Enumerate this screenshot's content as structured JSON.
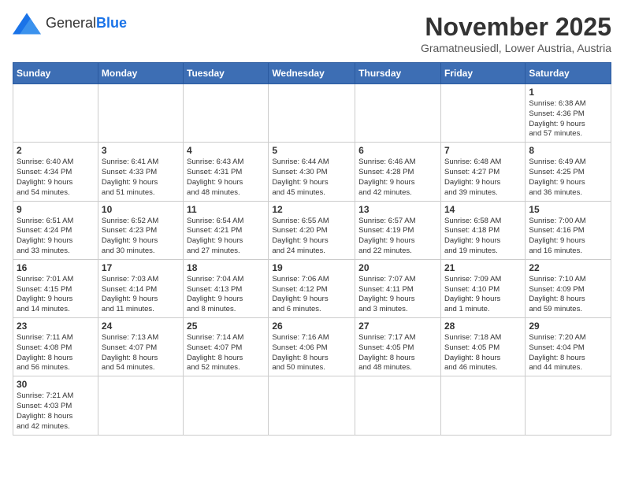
{
  "header": {
    "logo_general": "General",
    "logo_blue": "Blue",
    "title": "November 2025",
    "subtitle": "Gramatneusiedl, Lower Austria, Austria"
  },
  "weekdays": [
    "Sunday",
    "Monday",
    "Tuesday",
    "Wednesday",
    "Thursday",
    "Friday",
    "Saturday"
  ],
  "weeks": [
    [
      {
        "day": "",
        "info": ""
      },
      {
        "day": "",
        "info": ""
      },
      {
        "day": "",
        "info": ""
      },
      {
        "day": "",
        "info": ""
      },
      {
        "day": "",
        "info": ""
      },
      {
        "day": "",
        "info": ""
      },
      {
        "day": "1",
        "info": "Sunrise: 6:38 AM\nSunset: 4:36 PM\nDaylight: 9 hours\nand 57 minutes."
      }
    ],
    [
      {
        "day": "2",
        "info": "Sunrise: 6:40 AM\nSunset: 4:34 PM\nDaylight: 9 hours\nand 54 minutes."
      },
      {
        "day": "3",
        "info": "Sunrise: 6:41 AM\nSunset: 4:33 PM\nDaylight: 9 hours\nand 51 minutes."
      },
      {
        "day": "4",
        "info": "Sunrise: 6:43 AM\nSunset: 4:31 PM\nDaylight: 9 hours\nand 48 minutes."
      },
      {
        "day": "5",
        "info": "Sunrise: 6:44 AM\nSunset: 4:30 PM\nDaylight: 9 hours\nand 45 minutes."
      },
      {
        "day": "6",
        "info": "Sunrise: 6:46 AM\nSunset: 4:28 PM\nDaylight: 9 hours\nand 42 minutes."
      },
      {
        "day": "7",
        "info": "Sunrise: 6:48 AM\nSunset: 4:27 PM\nDaylight: 9 hours\nand 39 minutes."
      },
      {
        "day": "8",
        "info": "Sunrise: 6:49 AM\nSunset: 4:25 PM\nDaylight: 9 hours\nand 36 minutes."
      }
    ],
    [
      {
        "day": "9",
        "info": "Sunrise: 6:51 AM\nSunset: 4:24 PM\nDaylight: 9 hours\nand 33 minutes."
      },
      {
        "day": "10",
        "info": "Sunrise: 6:52 AM\nSunset: 4:23 PM\nDaylight: 9 hours\nand 30 minutes."
      },
      {
        "day": "11",
        "info": "Sunrise: 6:54 AM\nSunset: 4:21 PM\nDaylight: 9 hours\nand 27 minutes."
      },
      {
        "day": "12",
        "info": "Sunrise: 6:55 AM\nSunset: 4:20 PM\nDaylight: 9 hours\nand 24 minutes."
      },
      {
        "day": "13",
        "info": "Sunrise: 6:57 AM\nSunset: 4:19 PM\nDaylight: 9 hours\nand 22 minutes."
      },
      {
        "day": "14",
        "info": "Sunrise: 6:58 AM\nSunset: 4:18 PM\nDaylight: 9 hours\nand 19 minutes."
      },
      {
        "day": "15",
        "info": "Sunrise: 7:00 AM\nSunset: 4:16 PM\nDaylight: 9 hours\nand 16 minutes."
      }
    ],
    [
      {
        "day": "16",
        "info": "Sunrise: 7:01 AM\nSunset: 4:15 PM\nDaylight: 9 hours\nand 14 minutes."
      },
      {
        "day": "17",
        "info": "Sunrise: 7:03 AM\nSunset: 4:14 PM\nDaylight: 9 hours\nand 11 minutes."
      },
      {
        "day": "18",
        "info": "Sunrise: 7:04 AM\nSunset: 4:13 PM\nDaylight: 9 hours\nand 8 minutes."
      },
      {
        "day": "19",
        "info": "Sunrise: 7:06 AM\nSunset: 4:12 PM\nDaylight: 9 hours\nand 6 minutes."
      },
      {
        "day": "20",
        "info": "Sunrise: 7:07 AM\nSunset: 4:11 PM\nDaylight: 9 hours\nand 3 minutes."
      },
      {
        "day": "21",
        "info": "Sunrise: 7:09 AM\nSunset: 4:10 PM\nDaylight: 9 hours\nand 1 minute."
      },
      {
        "day": "22",
        "info": "Sunrise: 7:10 AM\nSunset: 4:09 PM\nDaylight: 8 hours\nand 59 minutes."
      }
    ],
    [
      {
        "day": "23",
        "info": "Sunrise: 7:11 AM\nSunset: 4:08 PM\nDaylight: 8 hours\nand 56 minutes."
      },
      {
        "day": "24",
        "info": "Sunrise: 7:13 AM\nSunset: 4:07 PM\nDaylight: 8 hours\nand 54 minutes."
      },
      {
        "day": "25",
        "info": "Sunrise: 7:14 AM\nSunset: 4:07 PM\nDaylight: 8 hours\nand 52 minutes."
      },
      {
        "day": "26",
        "info": "Sunrise: 7:16 AM\nSunset: 4:06 PM\nDaylight: 8 hours\nand 50 minutes."
      },
      {
        "day": "27",
        "info": "Sunrise: 7:17 AM\nSunset: 4:05 PM\nDaylight: 8 hours\nand 48 minutes."
      },
      {
        "day": "28",
        "info": "Sunrise: 7:18 AM\nSunset: 4:05 PM\nDaylight: 8 hours\nand 46 minutes."
      },
      {
        "day": "29",
        "info": "Sunrise: 7:20 AM\nSunset: 4:04 PM\nDaylight: 8 hours\nand 44 minutes."
      }
    ],
    [
      {
        "day": "30",
        "info": "Sunrise: 7:21 AM\nSunset: 4:03 PM\nDaylight: 8 hours\nand 42 minutes."
      },
      {
        "day": "",
        "info": ""
      },
      {
        "day": "",
        "info": ""
      },
      {
        "day": "",
        "info": ""
      },
      {
        "day": "",
        "info": ""
      },
      {
        "day": "",
        "info": ""
      },
      {
        "day": "",
        "info": ""
      }
    ]
  ]
}
